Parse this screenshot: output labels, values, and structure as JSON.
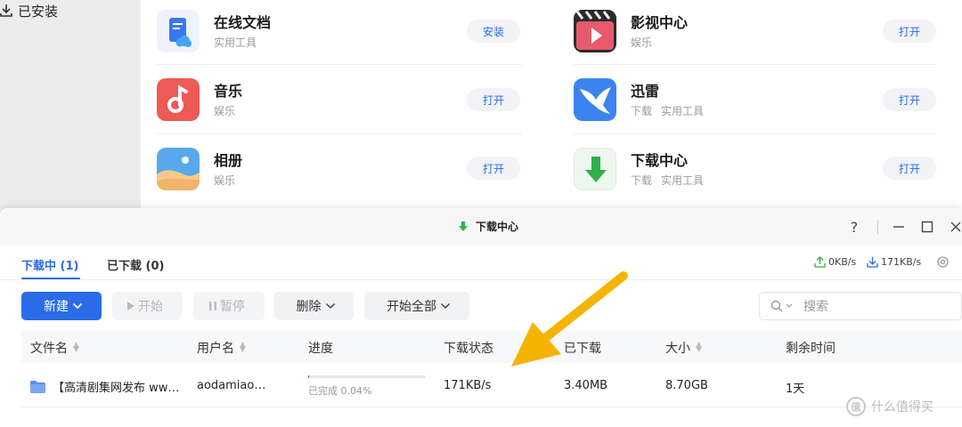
{
  "sidebar": {
    "installed_label": "已安装"
  },
  "apps": [
    {
      "name": "在线文档",
      "tags": [
        "实用工具"
      ],
      "button": "安装",
      "icon": "document-cloud-icon"
    },
    {
      "name": "影视中心",
      "tags": [
        "娱乐"
      ],
      "button": "打开",
      "icon": "video-clapper-icon"
    },
    {
      "name": "音乐",
      "tags": [
        "娱乐"
      ],
      "button": "打开",
      "icon": "music-note-icon"
    },
    {
      "name": "迅雷",
      "tags": [
        "下载",
        "实用工具"
      ],
      "button": "打开",
      "icon": "thunder-bird-icon"
    },
    {
      "name": "相册",
      "tags": [
        "娱乐"
      ],
      "button": "打开",
      "icon": "photo-album-icon"
    },
    {
      "name": "下载中心",
      "tags": [
        "下载",
        "实用工具"
      ],
      "button": "打开",
      "icon": "download-arrow-icon"
    }
  ],
  "download_window": {
    "title": "下载中心",
    "tabs": [
      {
        "label": "下载中 (1)",
        "active": true
      },
      {
        "label": "已下载 (0)",
        "active": false
      }
    ],
    "upload_speed": "0KB/s",
    "download_speed": "171KB/s",
    "toolbar": {
      "new_label": "新建",
      "start_label": "开始",
      "pause_label": "暂停",
      "delete_label": "删除",
      "start_all_label": "开始全部"
    },
    "search_placeholder": "搜索",
    "columns": {
      "filename": "文件名",
      "username": "用户名",
      "progress": "进度",
      "status": "下载状态",
      "downloaded": "已下载",
      "size": "大小",
      "remaining": "剩余时间"
    },
    "rows": [
      {
        "filename": "【高清剧集网发布 ww…",
        "username": "aodamiao…",
        "progress_text": "已完成 0.04%",
        "progress_percent": 0.04,
        "status": "171KB/s",
        "downloaded": "3.40MB",
        "size": "8.70GB",
        "remaining": "1天"
      }
    ]
  },
  "watermark": {
    "text": "什么值得买",
    "logo": "值"
  },
  "colors": {
    "accent": "#2a6be8",
    "arrow": "#f5b400"
  }
}
